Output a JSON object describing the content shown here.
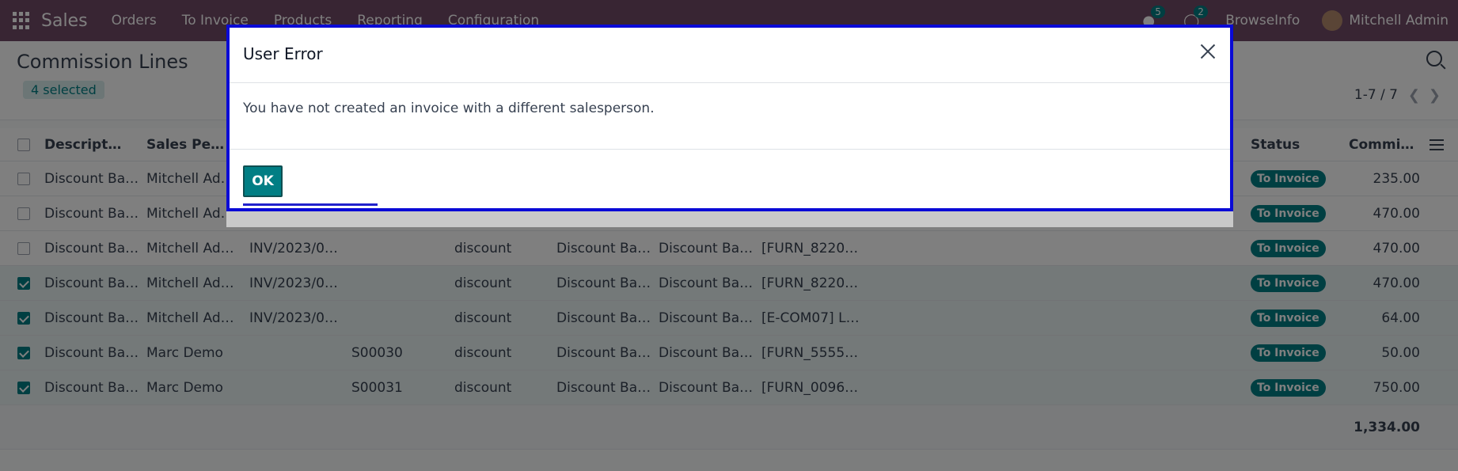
{
  "navbar": {
    "app_name": "Sales",
    "menu": [
      "Orders",
      "To Invoice",
      "Products",
      "Reporting",
      "Configuration"
    ],
    "messages_count": "5",
    "activities_count": "2",
    "company": "BrowseInfo",
    "user": "Mitchell Admin"
  },
  "control": {
    "title": "Commission Lines",
    "selected": "4 selected",
    "pager": "1-7 / 7"
  },
  "table": {
    "headers": {
      "description": "Descripti…",
      "salesperson": "Sales Per…",
      "status": "Status",
      "commission": "Commiss…"
    },
    "rows": [
      {
        "description": "Discount Bas…",
        "salesperson": "Mitchell Admin",
        "invoice": "",
        "order": "",
        "type": "",
        "rule": "",
        "basis": "",
        "product": "",
        "status": "To Invoice",
        "amount": "235.00",
        "selected": false
      },
      {
        "description": "Discount Bas…",
        "salesperson": "Mitchell Admin",
        "invoice": "",
        "order": "",
        "type": "",
        "rule": "",
        "basis": "",
        "product": "",
        "status": "To Invoice",
        "amount": "470.00",
        "selected": false
      },
      {
        "description": "Discount Bas…",
        "salesperson": "Mitchell Admin",
        "invoice": "INV/2023/00…",
        "order": "",
        "type": "discount",
        "rule": "Discount Bas…",
        "basis": "Discount Based",
        "product": "[FURN_8220]…",
        "status": "To Invoice",
        "amount": "470.00",
        "selected": false
      },
      {
        "description": "Discount Bas…",
        "salesperson": "Mitchell Admin",
        "invoice": "INV/2023/00…",
        "order": "",
        "type": "discount",
        "rule": "Discount Bas…",
        "basis": "Discount Based",
        "product": "[FURN_8220]…",
        "status": "To Invoice",
        "amount": "470.00",
        "selected": true
      },
      {
        "description": "Discount Bas…",
        "salesperson": "Mitchell Admin",
        "invoice": "INV/2023/00…",
        "order": "",
        "type": "discount",
        "rule": "Discount Bas…",
        "basis": "Discount Based",
        "product": "[E-COM07] L…",
        "status": "To Invoice",
        "amount": "64.00",
        "selected": true
      },
      {
        "description": "Discount Bas…",
        "salesperson": "Marc Demo",
        "invoice": "",
        "order": "S00030",
        "type": "discount",
        "rule": "Discount Bas…",
        "basis": "Discount Based",
        "product": "[FURN_5555]…",
        "status": "To Invoice",
        "amount": "50.00",
        "selected": true
      },
      {
        "description": "Discount Bas…",
        "salesperson": "Marc Demo",
        "invoice": "",
        "order": "S00031",
        "type": "discount",
        "rule": "Discount Bas…",
        "basis": "Discount Based",
        "product": "[FURN_0096]…",
        "status": "To Invoice",
        "amount": "750.00",
        "selected": true
      }
    ],
    "total": "1,334.00"
  },
  "dialog": {
    "title": "User Error",
    "message": "You have not created an invoice with a different salesperson.",
    "ok_label": "OK"
  }
}
